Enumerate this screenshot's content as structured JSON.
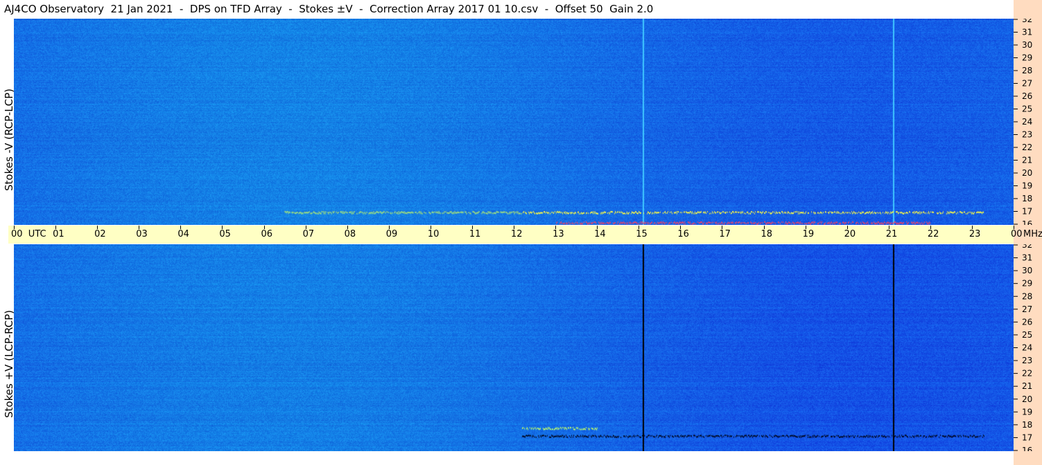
{
  "title": "AJ4CO Observatory  21 Jan 2021  -  DPS on TFD Array  -  Stokes ±V  -  Correction Array 2017 01 10.csv  -  Offset 50  Gain 2.0",
  "chart_data": [
    {
      "type": "heatmap",
      "panel": "top",
      "ylabel": "Stokes -V (RCP-LCP)",
      "y_unit": "MHz",
      "ylim": [
        16,
        32
      ],
      "yticks": [
        "32",
        "31",
        "30",
        "29",
        "28",
        "27",
        "26",
        "25",
        "24",
        "23",
        "22",
        "21",
        "20",
        "19",
        "18",
        "17",
        "16"
      ],
      "xlim_utc_hours": [
        0,
        24
      ],
      "colormap": [
        "#1a3fd0",
        "#0a66ee",
        "#1a8cff",
        "#40c0ff",
        "#c8ff60",
        "#ffff40",
        "#ff4060"
      ],
      "features": [
        {
          "kind": "vertical_line",
          "x_utc_hours": 15.1,
          "color": "#40c8ff"
        },
        {
          "kind": "vertical_line",
          "x_utc_hours": 21.1,
          "color": "#40c8ff"
        },
        {
          "kind": "emission_band",
          "x_utc_hours": [
            12.2,
            23.3
          ],
          "mhz": 17.0,
          "color": "#ffff40"
        },
        {
          "kind": "emission_band",
          "x_utc_hours": [
            6.5,
            12.2
          ],
          "mhz": 17.0,
          "color": "#c8ff60"
        },
        {
          "kind": "emission_band",
          "x_utc_hours": [
            13.0,
            22.0
          ],
          "mhz": 16.2,
          "color": "#ff4060"
        }
      ]
    },
    {
      "type": "heatmap",
      "panel": "bottom",
      "ylabel": "Stokes +V (LCP-RCP)",
      "y_unit": "MHz",
      "ylim": [
        16,
        32
      ],
      "yticks": [
        "32",
        "31",
        "30",
        "29",
        "28",
        "27",
        "26",
        "25",
        "24",
        "23",
        "22",
        "21",
        "20",
        "19",
        "18",
        "17",
        "16"
      ],
      "xlim_utc_hours": [
        0,
        24
      ],
      "features": [
        {
          "kind": "vertical_line",
          "x_utc_hours": 15.1,
          "color": "#000000"
        },
        {
          "kind": "vertical_line",
          "x_utc_hours": 21.1,
          "color": "#000000"
        },
        {
          "kind": "emission_band",
          "x_utc_hours": [
            12.2,
            23.3
          ],
          "mhz": 17.2,
          "color": "#000820"
        },
        {
          "kind": "emission_band",
          "x_utc_hours": [
            12.2,
            14.0
          ],
          "mhz": 17.8,
          "color": "#c8ff60"
        }
      ]
    }
  ],
  "time_axis": {
    "labels": [
      "00  UTC",
      "01",
      "02",
      "03",
      "04",
      "05",
      "06",
      "07",
      "08",
      "09",
      "10",
      "11",
      "12",
      "13",
      "14",
      "15",
      "16",
      "17",
      "18",
      "19",
      "20",
      "21",
      "22",
      "23",
      "00"
    ],
    "unit_label": "MHz"
  }
}
